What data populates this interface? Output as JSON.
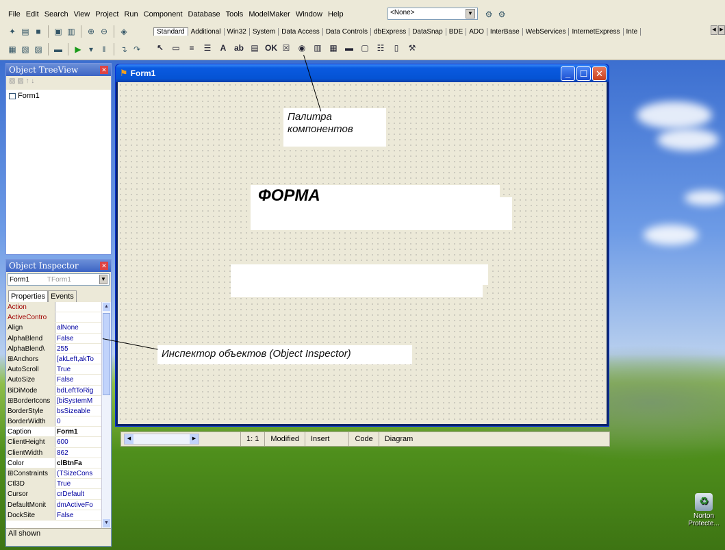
{
  "menu": [
    "File",
    "Edit",
    "Search",
    "View",
    "Project",
    "Run",
    "Component",
    "Database",
    "Tools",
    "ModelMaker",
    "Window",
    "Help"
  ],
  "desktop_combo": "<None>",
  "palette_tabs": [
    "Standard",
    "Additional",
    "Win32",
    "System",
    "Data Access",
    "Data Controls",
    "dbExpress",
    "DataSnap",
    "BDE",
    "ADO",
    "InterBase",
    "WebServices",
    "InternetExpress",
    "Inte"
  ],
  "palette_icons": [
    "pointer-icon",
    "frame-icon",
    "main-menu-icon",
    "popup-menu-icon",
    "label-icon",
    "edit-icon",
    "memo-icon",
    "button-icon",
    "checkbox-icon",
    "radio-button-icon",
    "listbox-icon",
    "combobox-icon",
    "scrollbar-icon",
    "groupbox-icon",
    "radiogroup-icon",
    "panel-icon",
    "actionlist-icon"
  ],
  "tree_view": {
    "title": "Object TreeView",
    "item": "Form1"
  },
  "inspector": {
    "title": "Object Inspector",
    "object": "Form1",
    "class": "TForm1",
    "tab_properties": "Properties",
    "tab_events": "Events",
    "status": "All shown",
    "rows": [
      {
        "k": "Action",
        "v": "",
        "red": true
      },
      {
        "k": "ActiveContro",
        "v": "",
        "red": true
      },
      {
        "k": "Align",
        "v": "alNone"
      },
      {
        "k": "AlphaBlend",
        "v": "False"
      },
      {
        "k": "AlphaBlend\\",
        "v": "255"
      },
      {
        "k": "⊞Anchors",
        "v": "[akLeft,akTo"
      },
      {
        "k": "AutoScroll",
        "v": "True"
      },
      {
        "k": "AutoSize",
        "v": "False"
      },
      {
        "k": "BiDiMode",
        "v": "bdLeftToRig"
      },
      {
        "k": "⊞BorderIcons",
        "v": "[biSystemM"
      },
      {
        "k": "BorderStyle",
        "v": "bsSizeable"
      },
      {
        "k": "BorderWidth",
        "v": "0"
      },
      {
        "k": "Caption",
        "v": "Form1",
        "sel": true
      },
      {
        "k": "ClientHeight",
        "v": "600"
      },
      {
        "k": "ClientWidth",
        "v": "862"
      },
      {
        "k": "Color",
        "v": "clBtnFa",
        "sel": true
      },
      {
        "k": "⊞Constraints",
        "v": "(TSizeCons"
      },
      {
        "k": "Ctl3D",
        "v": "True"
      },
      {
        "k": "Cursor",
        "v": "crDefault"
      },
      {
        "k": "DefaultMonit",
        "v": "dmActiveFo"
      },
      {
        "k": "DockSite",
        "v": "False"
      }
    ]
  },
  "form": {
    "title": "Form1",
    "big_label": "ФОРМА",
    "palette_callout_line1": "Палитра",
    "palette_callout_line2": "компонентов",
    "inspector_callout": "Инспектор объектов (Object Inspector)"
  },
  "editor_status": {
    "position": "1: 1",
    "modified": "Modified",
    "mode": "Insert",
    "tab_code": "Code",
    "tab_diagram": "Diagram"
  },
  "desktop_icon": {
    "label_line1": "Norton",
    "label_line2": "Protecte..."
  }
}
